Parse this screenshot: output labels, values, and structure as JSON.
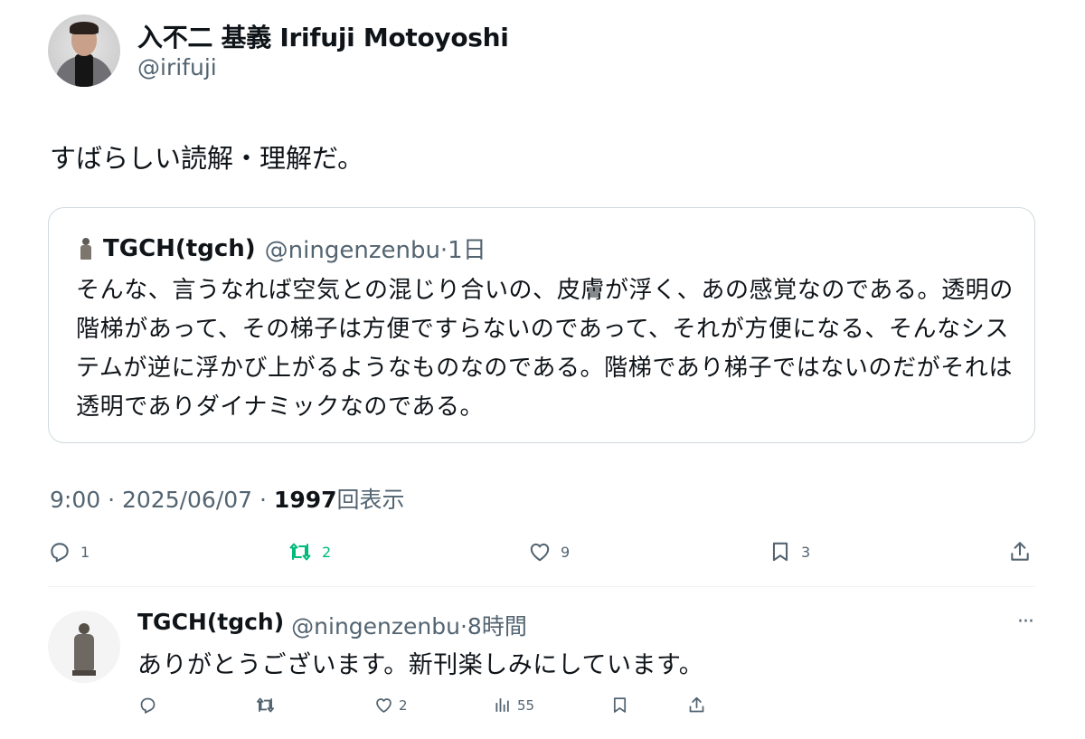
{
  "author": {
    "name": "入不二 基義 Irifuji Motoyoshi",
    "handle": "@irifuji"
  },
  "post": {
    "text": "すばらしい読解・理解だ。"
  },
  "quote": {
    "name": "TGCH(tgch)",
    "meta": "@ningenzenbu·1日",
    "body": "そんな、言うなれば空気との混じり合いの、皮膚が浮く、あの感覚なのである。透明の階梯があって、その梯子は方便ですらないのであって、それが方便になる、そんなシステムが逆に浮かび上がるようなものなのである。階梯であり梯子ではないのだがそれは透明でありダイナミックなのである。"
  },
  "meta": {
    "time_date": "9:00 · 2025/06/07 · ",
    "views_count": "1997",
    "views_label": "回表示"
  },
  "actions": {
    "replies": "1",
    "retweets": "2",
    "likes": "9",
    "bookmarks": "3"
  },
  "reply": {
    "name": "TGCH(tgch)",
    "meta": "@ningenzenbu·8時間",
    "text": "ありがとうございます。新刊楽しみにしています。",
    "more": "···",
    "actions": {
      "likes": "2",
      "views": "55"
    }
  },
  "colors": {
    "text": "#0f1419",
    "secondary": "#536471",
    "retweet_active": "#00ba7c",
    "border": "#cfd9de"
  },
  "icons": [
    "reply-icon",
    "retweet-icon",
    "like-icon",
    "bookmark-icon",
    "share-icon",
    "views-icon",
    "more-icon"
  ]
}
